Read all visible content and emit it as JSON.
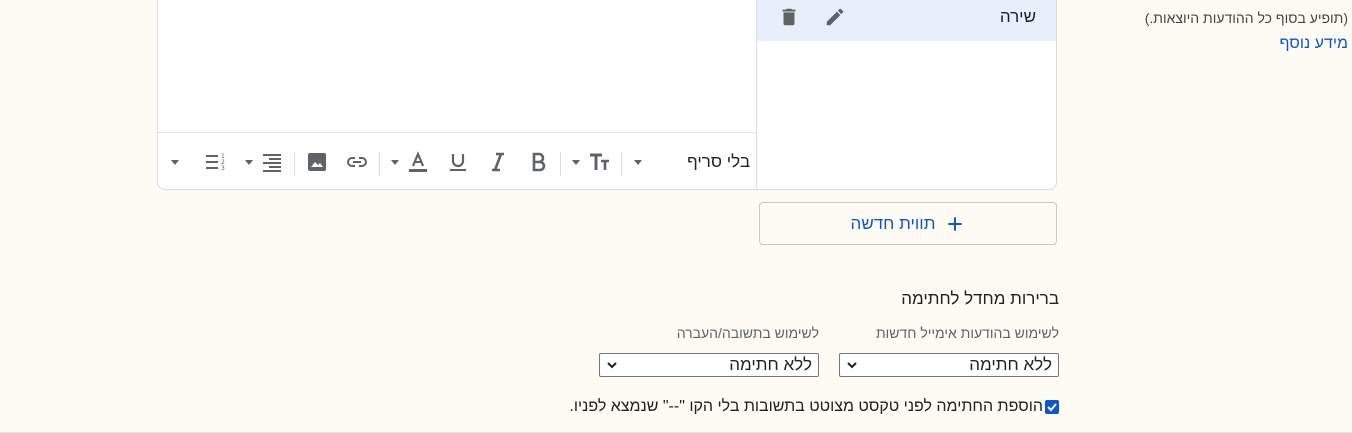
{
  "info": {
    "note": "(תופיע בסוף כל ההודעות היוצאות.)",
    "more_link": "מידע נוסף"
  },
  "signatures": {
    "items": [
      {
        "name": "שירה",
        "selected": true
      }
    ]
  },
  "editor": {
    "font": "בלי סריף",
    "toolbar_icons": [
      "font-dropdown-caret",
      "text-size-icon",
      "bold-icon",
      "italic-icon",
      "underline-icon",
      "text-color-icon",
      "link-icon",
      "image-icon",
      "align-icon",
      "list-icon",
      "more-formatting-caret"
    ]
  },
  "new_label_button": "תווית חדשה",
  "defaults": {
    "title": "ברירות מחדל לחתימה",
    "new_messages_label": "לשימוש בהודעות אימייל חדשות",
    "reply_label": "לשימוש בתשובה/העברה",
    "new_messages_value": "ללא חתימה",
    "reply_value": "ללא חתימה"
  },
  "checkbox": {
    "checked": true,
    "label": "הוספת החתימה לפני טקסט מצוטט בתשובות בלי הקו \"--\" שנמצא לפניו."
  },
  "colors": {
    "background": "#fdfbf3",
    "accent": "#0b57d0",
    "selected_item": "#e8eefa"
  }
}
